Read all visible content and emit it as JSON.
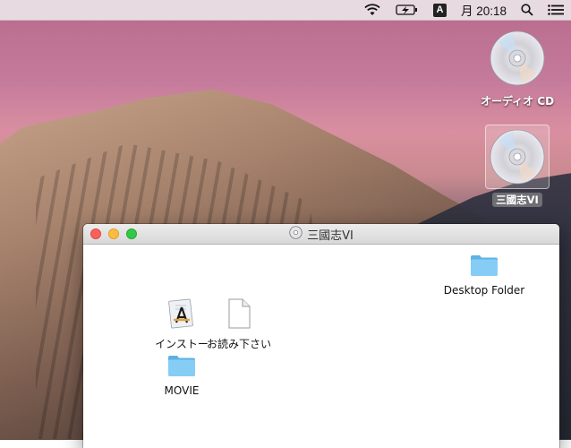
{
  "menubar": {
    "input_source": "A",
    "clock": "月 20:18",
    "icons": [
      "wifi-icon",
      "battery-charging-icon",
      "input-source-icon",
      "spotlight-icon",
      "notification-center-icon"
    ]
  },
  "desktop": {
    "icons": [
      {
        "label": "オーディオ CD",
        "icon": "cd-icon",
        "selected": false
      },
      {
        "label": "三國志VI",
        "icon": "cd-icon",
        "selected": true
      }
    ]
  },
  "window": {
    "title": "三國志VI",
    "title_icon": "cd-icon",
    "items": [
      {
        "label": "Desktop Folder",
        "icon": "folder-icon"
      },
      {
        "label": "インストー",
        "icon": "installer-app-icon"
      },
      {
        "label": "お読み下さい",
        "icon": "document-icon"
      },
      {
        "label": "MOVIE",
        "icon": "folder-icon"
      }
    ]
  },
  "colors": {
    "close": "#fc605c",
    "minimize": "#fdbc40",
    "zoom": "#34c84a",
    "folder": "#6ec3f0"
  }
}
